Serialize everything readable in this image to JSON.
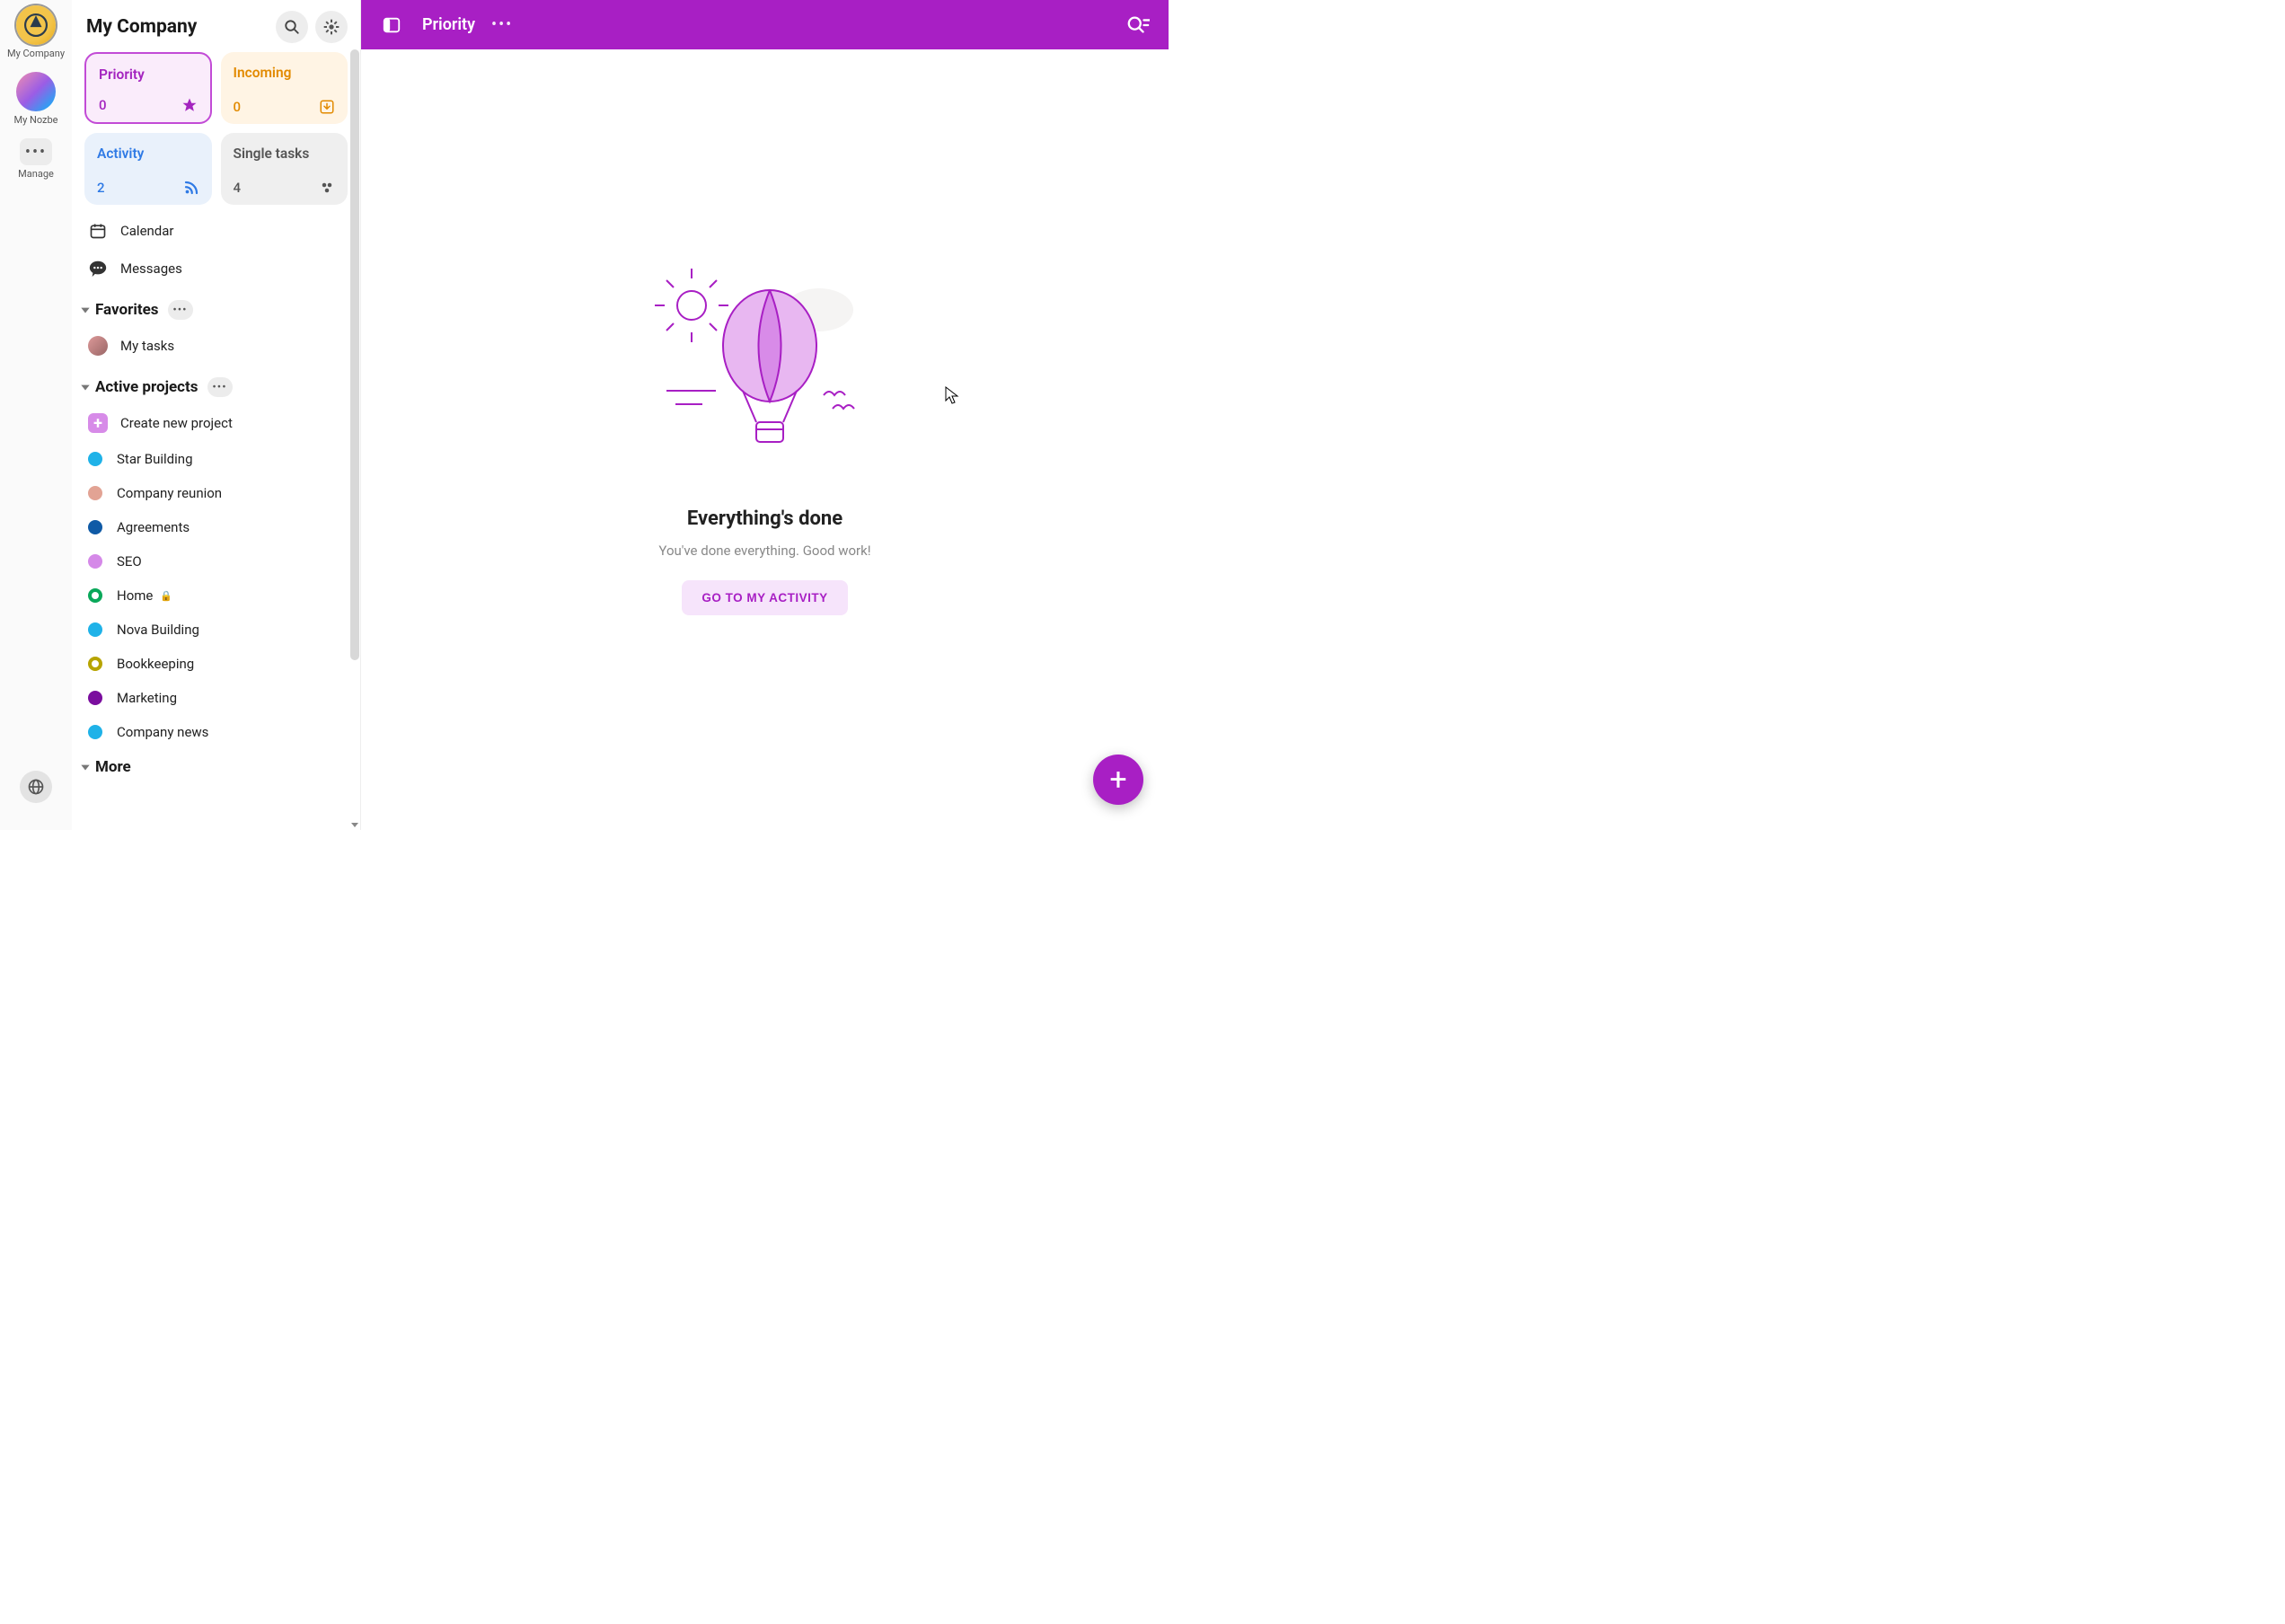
{
  "rail": {
    "items": [
      {
        "label": "My Company"
      },
      {
        "label": "My Nozbe"
      },
      {
        "label": "Manage"
      }
    ]
  },
  "sidebar": {
    "title": "My Company",
    "tiles": {
      "priority": {
        "name": "Priority",
        "count": "0"
      },
      "incoming": {
        "name": "Incoming",
        "count": "0"
      },
      "activity": {
        "name": "Activity",
        "count": "2"
      },
      "single": {
        "name": "Single tasks",
        "count": "4"
      }
    },
    "quick": {
      "calendar": "Calendar",
      "messages": "Messages"
    },
    "favorites": {
      "title": "Favorites",
      "items": [
        {
          "label": "My tasks"
        }
      ]
    },
    "projects": {
      "title": "Active projects",
      "create_label": "Create new project",
      "items": [
        {
          "name": "Star Building",
          "color": "#1fb2e8",
          "style": "solid"
        },
        {
          "name": "Company reunion",
          "color": "#e2a394",
          "style": "solid"
        },
        {
          "name": "Agreements",
          "color": "#0f5aa6",
          "style": "solid"
        },
        {
          "name": "SEO",
          "color": "#d589e8",
          "style": "solid"
        },
        {
          "name": "Home",
          "color": "#0aa85a",
          "style": "ring",
          "locked": true
        },
        {
          "name": "Nova Building",
          "color": "#1fb2e8",
          "style": "solid"
        },
        {
          "name": "Bookkeeping",
          "color": "#b7a400",
          "style": "ring"
        },
        {
          "name": "Marketing",
          "color": "#7a0d9e",
          "style": "solid"
        },
        {
          "name": "Company news",
          "color": "#1fb2e8",
          "style": "solid"
        }
      ]
    },
    "more_title": "More"
  },
  "main": {
    "topbar_title": "Priority",
    "empty_title": "Everything's done",
    "empty_sub": "You've done everything. Good work!",
    "activity_btn": "GO TO MY ACTIVITY"
  },
  "colors": {
    "accent": "#a81fc4"
  }
}
